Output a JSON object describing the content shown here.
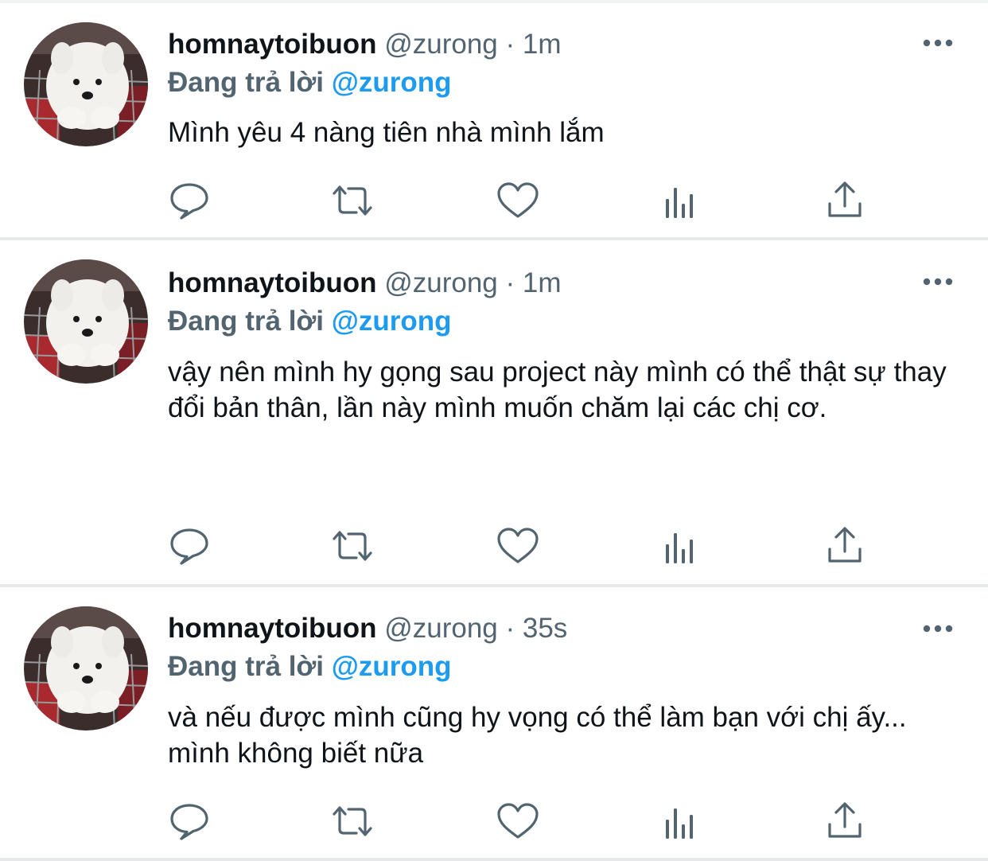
{
  "tweets": [
    {
      "author_name": "homnaytoibuon",
      "author_handle": "@zurong",
      "separator": "·",
      "time": "1m",
      "reply_label": "Đang trả lời",
      "reply_to": "@zurong",
      "text": "Mình yêu 4 nàng tiên nhà mình lắm"
    },
    {
      "author_name": "homnaytoibuon",
      "author_handle": "@zurong",
      "separator": "·",
      "time": "1m",
      "reply_label": "Đang trả lời",
      "reply_to": "@zurong",
      "text": "vậy nên mình hy gọng sau project này mình có thể thật sự thay đổi bản thân, lần này mình muốn chăm lại các chị cơ."
    },
    {
      "author_name": "homnaytoibuon",
      "author_handle": "@zurong",
      "separator": "·",
      "time": "35s",
      "reply_label": "Đang trả lời",
      "reply_to": "@zurong",
      "text": "và nếu được mình cũng hy vọng có thể làm bạn với chị ấy... mình không biết nữa"
    }
  ],
  "icons": {
    "reply": "reply-icon",
    "retweet": "retweet-icon",
    "like": "heart-icon",
    "analytics": "analytics-icon",
    "share": "share-icon",
    "more": "more-icon",
    "avatar": "dog-avatar"
  },
  "colors": {
    "primary_text": "#0f1419",
    "secondary_text": "#536471",
    "mention": "#1d9bf0",
    "divider": "#e6e9ea"
  }
}
